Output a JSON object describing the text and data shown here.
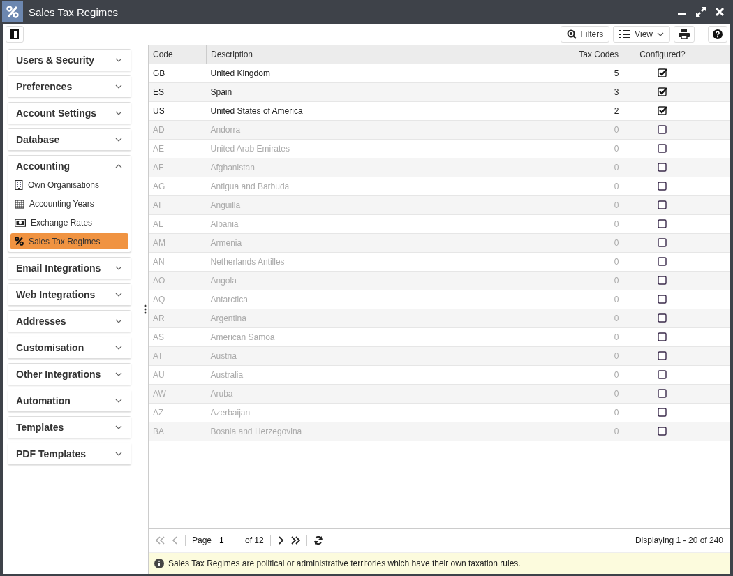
{
  "window": {
    "title": "Sales Tax Regimes"
  },
  "toolbar": {
    "filters": "Filters",
    "view": "View"
  },
  "sidebar": [
    {
      "label": "Users & Security",
      "expanded": false
    },
    {
      "label": "Preferences",
      "expanded": false
    },
    {
      "label": "Account Settings",
      "expanded": false
    },
    {
      "label": "Database",
      "expanded": false
    },
    {
      "label": "Accounting",
      "expanded": true,
      "children": [
        {
          "label": "Own Organisations",
          "kind": "building",
          "selected": false
        },
        {
          "label": "Accounting Years",
          "kind": "calendar",
          "selected": false
        },
        {
          "label": "Exchange Rates",
          "kind": "money",
          "selected": false
        },
        {
          "label": "Sales Tax Regimes",
          "kind": "percent",
          "selected": true
        }
      ]
    },
    {
      "label": "Email Integrations",
      "expanded": false
    },
    {
      "label": "Web Integrations",
      "expanded": false
    },
    {
      "label": "Addresses",
      "expanded": false
    },
    {
      "label": "Customisation",
      "expanded": false
    },
    {
      "label": "Other Integrations",
      "expanded": false
    },
    {
      "label": "Automation",
      "expanded": false
    },
    {
      "label": "Templates",
      "expanded": false
    },
    {
      "label": "PDF Templates",
      "expanded": false
    }
  ],
  "table": {
    "columns": [
      "Code",
      "Description",
      "Tax Codes",
      "Configured?"
    ],
    "rows": [
      {
        "code": "GB",
        "description": "United Kingdom",
        "tax_codes": "5",
        "configured": true
      },
      {
        "code": "ES",
        "description": "Spain",
        "tax_codes": "3",
        "configured": true
      },
      {
        "code": "US",
        "description": "United States of America",
        "tax_codes": "2",
        "configured": true
      },
      {
        "code": "AD",
        "description": "Andorra",
        "tax_codes": "0",
        "configured": false
      },
      {
        "code": "AE",
        "description": "United Arab Emirates",
        "tax_codes": "0",
        "configured": false
      },
      {
        "code": "AF",
        "description": "Afghanistan",
        "tax_codes": "0",
        "configured": false
      },
      {
        "code": "AG",
        "description": "Antigua and Barbuda",
        "tax_codes": "0",
        "configured": false
      },
      {
        "code": "AI",
        "description": "Anguilla",
        "tax_codes": "0",
        "configured": false
      },
      {
        "code": "AL",
        "description": "Albania",
        "tax_codes": "0",
        "configured": false
      },
      {
        "code": "AM",
        "description": "Armenia",
        "tax_codes": "0",
        "configured": false
      },
      {
        "code": "AN",
        "description": "Netherlands Antilles",
        "tax_codes": "0",
        "configured": false
      },
      {
        "code": "AO",
        "description": "Angola",
        "tax_codes": "0",
        "configured": false
      },
      {
        "code": "AQ",
        "description": "Antarctica",
        "tax_codes": "0",
        "configured": false
      },
      {
        "code": "AR",
        "description": "Argentina",
        "tax_codes": "0",
        "configured": false
      },
      {
        "code": "AS",
        "description": "American Samoa",
        "tax_codes": "0",
        "configured": false
      },
      {
        "code": "AT",
        "description": "Austria",
        "tax_codes": "0",
        "configured": false
      },
      {
        "code": "AU",
        "description": "Australia",
        "tax_codes": "0",
        "configured": false
      },
      {
        "code": "AW",
        "description": "Aruba",
        "tax_codes": "0",
        "configured": false
      },
      {
        "code": "AZ",
        "description": "Azerbaijan",
        "tax_codes": "0",
        "configured": false
      },
      {
        "code": "BA",
        "description": "Bosnia and Herzegovina",
        "tax_codes": "0",
        "configured": false
      }
    ]
  },
  "pager": {
    "first_disabled": true,
    "prev_disabled": true,
    "page_label": "Page",
    "page": "1",
    "of": "of 12",
    "display": "Displaying 1 - 20 of 240"
  },
  "info": "Sales Tax Regimes are political or administrative territories which have their own taxation rules."
}
